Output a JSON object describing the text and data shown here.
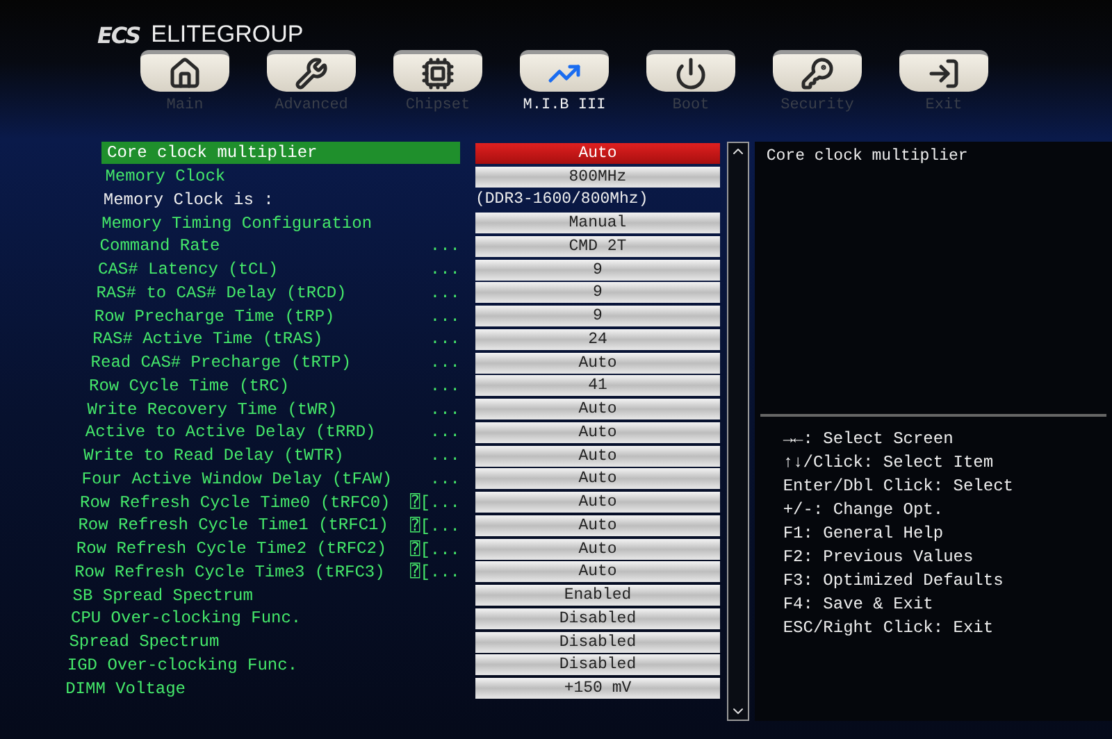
{
  "brand": {
    "logo": "ECS",
    "name": "ELITEGROUP"
  },
  "tabs": [
    {
      "label": "Main",
      "selected": false
    },
    {
      "label": "Advanced",
      "selected": false
    },
    {
      "label": "Chipset",
      "selected": false
    },
    {
      "label": "M.I.B III",
      "selected": true
    },
    {
      "label": "Boot",
      "selected": false
    },
    {
      "label": "Security",
      "selected": false
    },
    {
      "label": "Exit",
      "selected": false
    }
  ],
  "settings": [
    {
      "label": "Core clock multiplier",
      "value": "Auto",
      "kind": "option",
      "selected": true
    },
    {
      "label": "Memory Clock",
      "value": "800MHz",
      "kind": "option",
      "selected": false
    },
    {
      "label": "Memory Clock is :",
      "value": "(DDR3-1600/800Mhz)",
      "kind": "info",
      "selected": false
    },
    {
      "label": "Memory Timing Configuration",
      "value": "Manual",
      "kind": "option",
      "selected": false
    },
    {
      "label": "Command Rate",
      "suffix": "...",
      "value": "CMD 2T",
      "kind": "option",
      "selected": false
    },
    {
      "label": "CAS# Latency (tCL)",
      "suffix": "...",
      "value": "9",
      "kind": "option",
      "selected": false
    },
    {
      "label": "RAS# to CAS# Delay (tRCD)",
      "suffix": "...",
      "value": "9",
      "kind": "option",
      "selected": false
    },
    {
      "label": "Row Precharge Time (tRP)",
      "suffix": "...",
      "value": "9",
      "kind": "option",
      "selected": false
    },
    {
      "label": "RAS# Active Time (tRAS)",
      "suffix": "...",
      "value": "24",
      "kind": "option",
      "selected": false
    },
    {
      "label": "Read CAS# Precharge (tRTP)",
      "suffix": "...",
      "value": "Auto",
      "kind": "option",
      "selected": false
    },
    {
      "label": "Row Cycle Time (tRC)",
      "suffix": "...",
      "value": "41",
      "kind": "option",
      "selected": false
    },
    {
      "label": "Write Recovery Time (tWR)",
      "suffix": "...",
      "value": "Auto",
      "kind": "option",
      "selected": false
    },
    {
      "label": "Active to Active Delay (tRRD)",
      "suffix": "...",
      "value": "Auto",
      "kind": "option",
      "selected": false
    },
    {
      "label": "Write to Read Delay (tWTR)",
      "suffix": "...",
      "value": "Auto",
      "kind": "option",
      "selected": false
    },
    {
      "label": "Four Active Window Delay (tFAW)",
      "suffix": "...",
      "value": "Auto",
      "kind": "option",
      "selected": false
    },
    {
      "label": "Row Refresh Cycle Time0 (tRFC0)",
      "suffix": "⍰[...",
      "value": "Auto",
      "kind": "option",
      "selected": false
    },
    {
      "label": "Row Refresh Cycle Time1 (tRFC1)",
      "suffix": "⍰[...",
      "value": "Auto",
      "kind": "option",
      "selected": false
    },
    {
      "label": "Row Refresh Cycle Time2 (tRFC2)",
      "suffix": "⍰[...",
      "value": "Auto",
      "kind": "option",
      "selected": false
    },
    {
      "label": "Row Refresh Cycle Time3 (tRFC3)",
      "suffix": "⍰[...",
      "value": "Auto",
      "kind": "option",
      "selected": false
    },
    {
      "label": "SB Spread Spectrum",
      "value": "Enabled",
      "kind": "option",
      "selected": false
    },
    {
      "label": "CPU Over-clocking Func.",
      "value": "Disabled",
      "kind": "option",
      "selected": false
    },
    {
      "label": "Spread Spectrum",
      "value": "Disabled",
      "kind": "option",
      "selected": false
    },
    {
      "label": "IGD Over-clocking Func.",
      "value": "Disabled",
      "kind": "option",
      "selected": false
    },
    {
      "label": "DIMM Voltage",
      "value": "+150 mV",
      "kind": "option",
      "selected": false
    }
  ],
  "help": {
    "description": "Core clock multiplier",
    "keys": [
      "→←: Select Screen",
      "↑↓/Click: Select Item",
      "Enter/Dbl Click: Select",
      "+/-: Change Opt.",
      "F1: General Help",
      "F2: Previous Values",
      "F3: Optimized Defaults",
      "F4: Save & Exit",
      "ESC/Right Click: Exit"
    ]
  }
}
